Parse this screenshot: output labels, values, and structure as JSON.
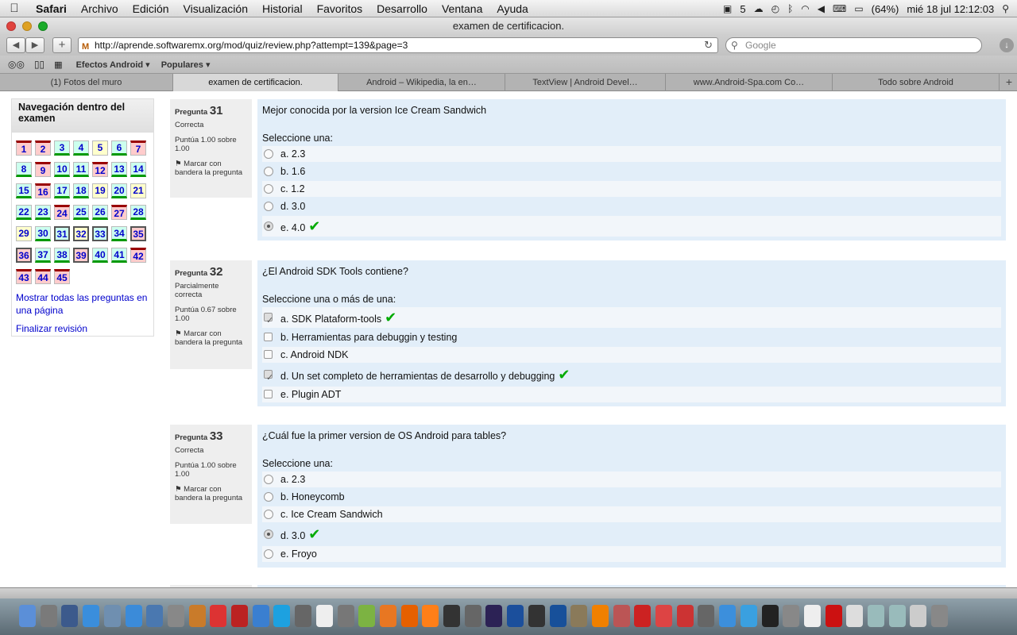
{
  "menubar": {
    "apple": "",
    "items": [
      "Safari",
      "Archivo",
      "Edición",
      "Visualización",
      "Historial",
      "Favoritos",
      "Desarrollo",
      "Ventana",
      "Ayuda"
    ],
    "right": {
      "adobe_count": "5",
      "battery": "(64%)",
      "datetime": "mié 18 jul  12:12:03"
    }
  },
  "window": {
    "title": "examen de certificacion.",
    "url": "http://aprende.softwaremx.org/mod/quiz/review.php?attempt=139&page=3",
    "search_placeholder": "Google",
    "bookmarks": [
      "Efectos Android ▾",
      "Populares ▾"
    ],
    "tabs": [
      {
        "label": "(1) Fotos del muro",
        "active": false
      },
      {
        "label": "examen de certificacion.",
        "active": true
      },
      {
        "label": "Android – Wikipedia, la en…",
        "active": false
      },
      {
        "label": "TextView | Android Devel…",
        "active": false
      },
      {
        "label": "www.Android-Spa.com Co…",
        "active": false
      },
      {
        "label": "Todo sobre Android",
        "active": false
      }
    ]
  },
  "nav": {
    "title": "Navegación dentro del examen",
    "buttons": [
      {
        "n": "1",
        "s": "r"
      },
      {
        "n": "2",
        "s": "r"
      },
      {
        "n": "3",
        "s": "g"
      },
      {
        "n": "4",
        "s": "g"
      },
      {
        "n": "5",
        "s": "y"
      },
      {
        "n": "6",
        "s": "g"
      },
      {
        "n": "7",
        "s": "r"
      },
      {
        "n": "8",
        "s": "g"
      },
      {
        "n": "9",
        "s": "r"
      },
      {
        "n": "10",
        "s": "g"
      },
      {
        "n": "11",
        "s": "g"
      },
      {
        "n": "12",
        "s": "r"
      },
      {
        "n": "13",
        "s": "g"
      },
      {
        "n": "14",
        "s": "g"
      },
      {
        "n": "15",
        "s": "g"
      },
      {
        "n": "16",
        "s": "r"
      },
      {
        "n": "17",
        "s": "g"
      },
      {
        "n": "18",
        "s": "g"
      },
      {
        "n": "19",
        "s": "y"
      },
      {
        "n": "20",
        "s": "g"
      },
      {
        "n": "21",
        "s": "y"
      },
      {
        "n": "22",
        "s": "g"
      },
      {
        "n": "23",
        "s": "g"
      },
      {
        "n": "24",
        "s": "r"
      },
      {
        "n": "25",
        "s": "g"
      },
      {
        "n": "26",
        "s": "g"
      },
      {
        "n": "27",
        "s": "r"
      },
      {
        "n": "28",
        "s": "g"
      },
      {
        "n": "29",
        "s": "y"
      },
      {
        "n": "30",
        "s": "g"
      },
      {
        "n": "31",
        "s": "gc"
      },
      {
        "n": "32",
        "s": "yc"
      },
      {
        "n": "33",
        "s": "gc"
      },
      {
        "n": "34",
        "s": "g"
      },
      {
        "n": "35",
        "s": "rc"
      },
      {
        "n": "36",
        "s": "rc"
      },
      {
        "n": "37",
        "s": "g"
      },
      {
        "n": "38",
        "s": "g"
      },
      {
        "n": "39",
        "s": "rc"
      },
      {
        "n": "40",
        "s": "g"
      },
      {
        "n": "41",
        "s": "g"
      },
      {
        "n": "42",
        "s": "r"
      },
      {
        "n": "43",
        "s": "r"
      },
      {
        "n": "44",
        "s": "r"
      },
      {
        "n": "45",
        "s": "r"
      }
    ],
    "show_all": "Mostrar todas las preguntas en una página",
    "finish": "Finalizar revisión"
  },
  "questions": [
    {
      "label": "Pregunta",
      "number": "31",
      "status": "Correcta",
      "grade": "Puntúa 1.00 sobre 1.00",
      "flag": "Marcar con bandera la pregunta",
      "text": "Mejor conocida por la version Ice Cream Sandwich",
      "prompt": "Seleccione una:",
      "kind": "radio",
      "options": [
        {
          "text": "a. 2.3",
          "selected": false,
          "correct": false
        },
        {
          "text": "b. 1.6",
          "selected": false,
          "correct": false
        },
        {
          "text": "c. 1.2",
          "selected": false,
          "correct": false
        },
        {
          "text": "d. 3.0",
          "selected": false,
          "correct": false
        },
        {
          "text": "e. 4.0",
          "selected": true,
          "correct": true
        }
      ]
    },
    {
      "label": "Pregunta",
      "number": "32",
      "status": "Parcialmente correcta",
      "grade": "Puntúa 0.67 sobre 1.00",
      "flag": "Marcar con bandera la pregunta",
      "text": "¿El Android SDK Tools contiene?",
      "prompt": "Seleccione una o más de una:",
      "kind": "checkbox",
      "options": [
        {
          "text": "a. SDK Plataform-tools",
          "selected": true,
          "correct": true
        },
        {
          "text": "b. Herramientas para debuggin y testing",
          "selected": false,
          "correct": false
        },
        {
          "text": "c. Android NDK",
          "selected": false,
          "correct": false
        },
        {
          "text": "d. Un set completo de herramientas de desarrollo y debugging",
          "selected": true,
          "correct": true
        },
        {
          "text": "e. Plugin ADT",
          "selected": false,
          "correct": false
        }
      ]
    },
    {
      "label": "Pregunta",
      "number": "33",
      "status": "Correcta",
      "grade": "Puntúa 1.00 sobre 1.00",
      "flag": "Marcar con bandera la pregunta",
      "text": "¿Cuál fue la primer version de OS Android para tables?",
      "prompt": "Seleccione una:",
      "kind": "radio",
      "options": [
        {
          "text": "a. 2.3",
          "selected": false,
          "correct": false
        },
        {
          "text": "b. Honeycomb",
          "selected": false,
          "correct": false
        },
        {
          "text": "c. Ice Cream Sandwich",
          "selected": false,
          "correct": false
        },
        {
          "text": "d. 3.0",
          "selected": true,
          "correct": true
        },
        {
          "text": "e. Froyo",
          "selected": false,
          "correct": false
        }
      ]
    }
  ],
  "dock": [
    "finder-icon",
    "launchpad-icon",
    "dashboard-icon",
    "app-store-icon",
    "preview-icon",
    "safari-icon",
    "xcode-icon",
    "utilities-icon",
    "ibooks-icon",
    "calendar-icon",
    "filezilla-icon",
    "package-icon",
    "skype-icon",
    "system-prefs-icon",
    "textedit-icon",
    "photobooth-icon",
    "android-icon",
    "blender-icon",
    "firefox-icon",
    "illustrator-icon",
    "cocos-icon",
    "camera-icon",
    "eclipse-icon",
    "photoshop-icon",
    "unity-icon",
    "virtualbox-icon",
    "gimp-icon",
    "vlc-icon",
    "game-icon",
    "angry-birds-icon",
    "chrome-icon",
    "xmind-icon",
    "activity-icon",
    "itunes-icon",
    "twitter-icon",
    "terminal-icon",
    "preferences-icon",
    "script-icon",
    "flash-icon",
    "document-icon",
    "folder-icon",
    "downloads-icon",
    "image-icon",
    "trash-icon"
  ]
}
